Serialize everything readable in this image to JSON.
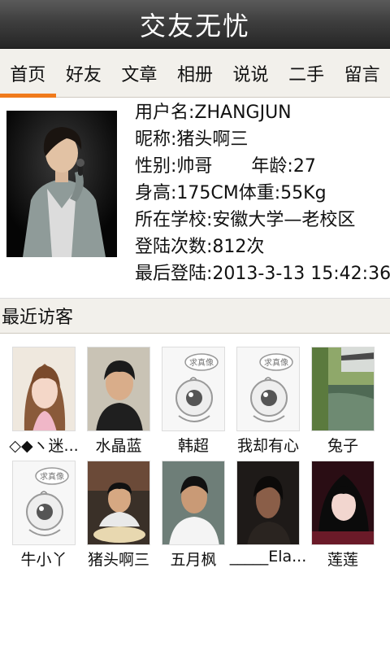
{
  "app": {
    "title": "交友无忧"
  },
  "tabs": [
    {
      "label": "首页",
      "active": true
    },
    {
      "label": "好友",
      "active": false
    },
    {
      "label": "文章",
      "active": false
    },
    {
      "label": "相册",
      "active": false
    },
    {
      "label": "说说",
      "active": false
    },
    {
      "label": "二手",
      "active": false
    },
    {
      "label": "留言",
      "active": false
    }
  ],
  "profile": {
    "username": "用户名:ZHANGJUN",
    "nickname": "昵称:猪头啊三",
    "gender": "性别:帅哥",
    "age": "年龄:27",
    "height_weight": "身高:175CM体重:55Kg",
    "school": "所在学校:安徽大学—老校区",
    "login_count": "登陆次数:812次",
    "last_login": "最后登陆:2013-3-13 15:42:36"
  },
  "recent_visitors": {
    "header": "最近访客",
    "items": [
      {
        "name": "◇◆ヽ迷...",
        "avatar": "girl-photo"
      },
      {
        "name": "水晶蓝",
        "avatar": "person-photo"
      },
      {
        "name": "韩超",
        "avatar": "default-avatar-icon"
      },
      {
        "name": "我却有心",
        "avatar": "default-avatar-icon"
      },
      {
        "name": "兔子",
        "avatar": "garden-photo"
      },
      {
        "name": "牛小丫",
        "avatar": "default-avatar-icon"
      },
      {
        "name": "猪头啊三",
        "avatar": "person-photo"
      },
      {
        "name": "五月枫",
        "avatar": "person-photo"
      },
      {
        "name": "_____Ela...",
        "avatar": "person-photo"
      },
      {
        "name": "莲莲",
        "avatar": "girl-photo"
      }
    ]
  },
  "placeholder_badge": "求真像",
  "colors": {
    "accent": "#f07a1b",
    "titlebar": "#3a3a3a",
    "tabbar": "#f2f0eb"
  }
}
